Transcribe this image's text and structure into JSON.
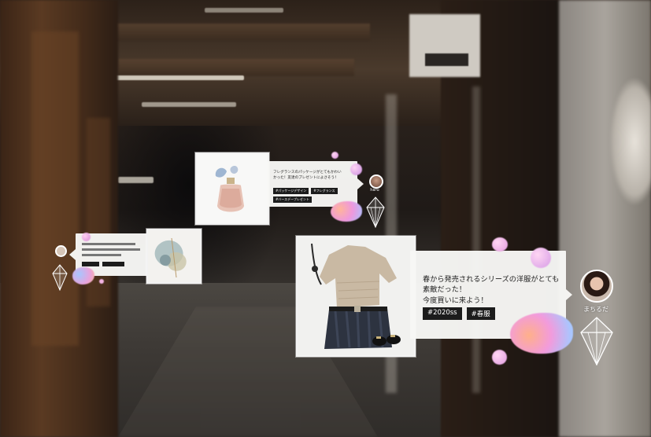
{
  "posts": [
    {
      "text": "春から発売されるシリーズの洋服がとても\n素敵だった！\n今度買いに来よう！",
      "tags": [
        "#2020ss",
        "#春服"
      ],
      "user": "まちるだ",
      "image_icon": "knit-sweater-outfit-icon"
    },
    {
      "text": "フレグランスのパッケージがとてもかわい\nかった！友達のプレゼントによさそう！",
      "tags": [
        "#パッケージデザイン",
        "#フレグランス",
        "#バースデープレゼント"
      ],
      "user": "haru",
      "image_icon": "perfume-bottle-icon"
    },
    {
      "text": "",
      "tags": [],
      "user": "",
      "image_icon": "abstract-art-icon"
    }
  ],
  "colors": {
    "bubble": "#f7f7f5",
    "tag_bg": "#1c1c1c",
    "blob_pink": "#f4a3d8",
    "blob_blue": "#9fc4ff",
    "blob_orange": "#ffb08a"
  }
}
